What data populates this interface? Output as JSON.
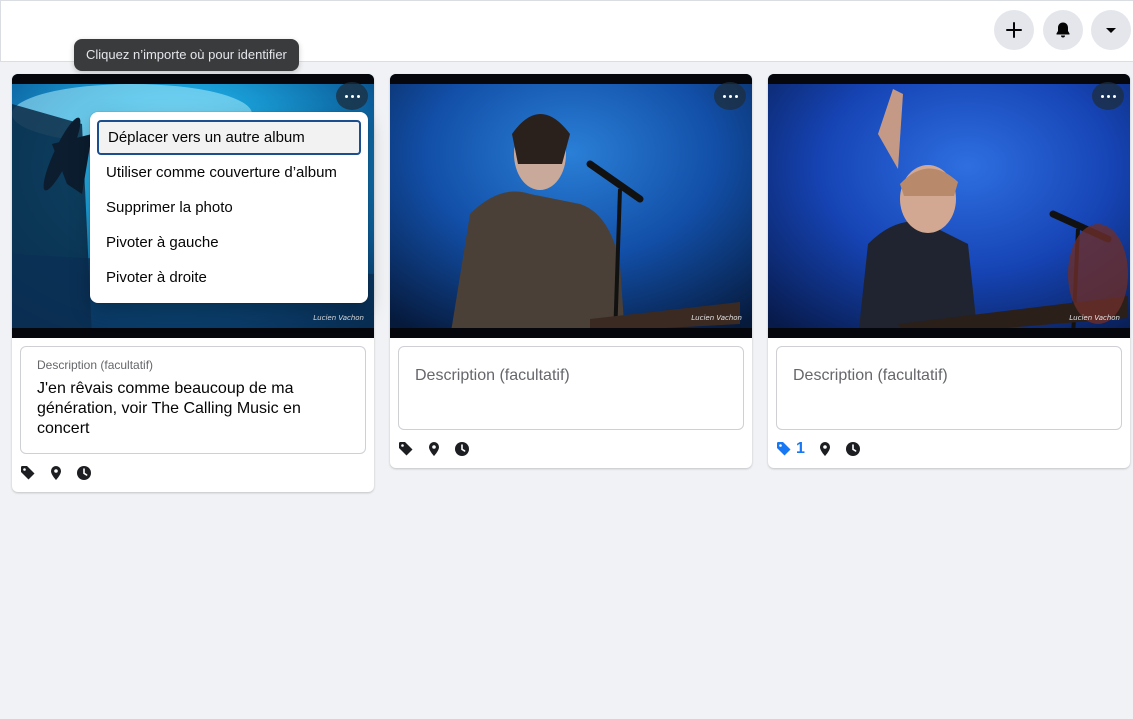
{
  "tooltip": "Cliquez n’importe où pour identifier",
  "topbar": {
    "buttons": [
      {
        "icon": "plus-icon"
      },
      {
        "icon": "bell-icon"
      },
      {
        "icon": "caret-down-icon"
      }
    ]
  },
  "menu": {
    "items": [
      "Déplacer vers un autre album",
      "Utiliser comme couverture d’album",
      "Supprimer la photo",
      "Pivoter à gauche",
      "Pivoter à droite"
    ]
  },
  "photos": [
    {
      "watermark": "Lucien Vachon",
      "description_label": "Description (facultatif)",
      "description": "J'en rêvais comme beaucoup de ma génération, voir The Calling Music en concert",
      "tags_count": ""
    },
    {
      "watermark": "Lucien Vachon",
      "description_placeholder": "Description (facultatif)",
      "tags_count": ""
    },
    {
      "watermark": "Lucien Vachon",
      "description_placeholder": "Description (facultatif)",
      "tags_count": "1"
    }
  ],
  "colors": {
    "accent": "#1877f2",
    "icon": "#1c1e21",
    "menu_focus_border": "#1b4e8f"
  }
}
